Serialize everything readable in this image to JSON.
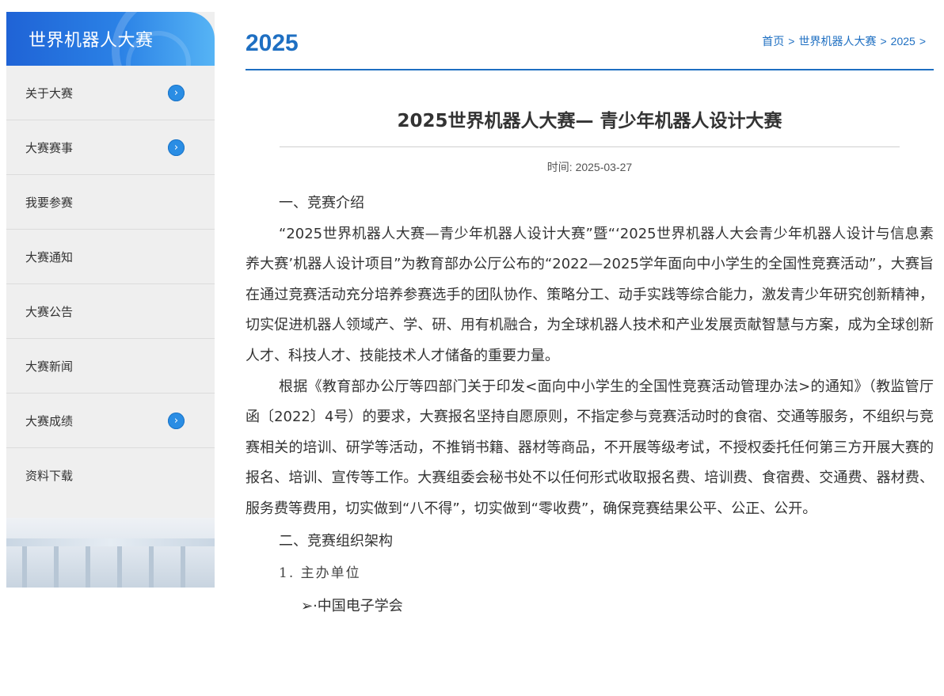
{
  "sidebar": {
    "title": "世界机器人大赛",
    "items": [
      {
        "label": "关于大赛",
        "arrow": "›"
      },
      {
        "label": "大赛赛事",
        "arrow": "›"
      },
      {
        "label": "我要参赛"
      },
      {
        "label": "大赛通知"
      },
      {
        "label": "大赛公告"
      },
      {
        "label": "大赛新闻"
      },
      {
        "label": "大赛成绩",
        "arrow": "›"
      },
      {
        "label": "资料下载"
      }
    ]
  },
  "header": {
    "year": "2025",
    "breadcrumb": [
      "首页",
      "世界机器人大赛",
      "2025"
    ],
    "separator": ">"
  },
  "article": {
    "title": "2025世界机器人大赛— 青少年机器人设计大赛",
    "time": "时间: 2025-03-27",
    "section1": "一、竞赛介绍",
    "para1": "“2025世界机器人大赛—青少年机器人设计大赛”暨“‘2025世界机器人大会青少年机器人设计与信息素养大赛’机器人设计项目”为教育部办公厅公布的“2022—2025学年面向中小学生的全国性竞赛活动”，大赛旨在通过竞赛活动充分培养参赛选手的团队协作、策略分工、动手实践等综合能力，激发青少年研究创新精神，切实促进机器人领域产、学、研、用有机融合，为全球机器人技术和产业发展贡献智慧与方案，成为全球创新人才、科技人才、技能技术人才储备的重要力量。",
    "para2": "根据《教育部办公厅等四部门关于印发<面向中小学生的全国性竞赛活动管理办法>的通知》（教监管厅函〔2022〕4号）的要求，大赛报名坚持自愿原则，不指定参与竞赛活动时的食宿、交通等服务，不组织与竞赛相关的培训、研学等活动，不推销书籍、器材等商品，不开展等级考试，不授权委托任何第三方开展大赛的报名、培训、宣传等工作。大赛组委会秘书处不以任何形式收取报名费、培训费、食宿费、交通费、器材费、服务费等费用，切实做到“八不得”，切实做到“零收费”，确保竞赛结果公平、公正、公开。",
    "section2": "二、竞赛组织架构",
    "sub1": "1. 主办单位",
    "bullet1": "➢·中国电子学会"
  },
  "colors": {
    "accent": "#1e6fc2",
    "sidebar_bg": "#efefef",
    "arrow_bg": "#2a8de4"
  }
}
